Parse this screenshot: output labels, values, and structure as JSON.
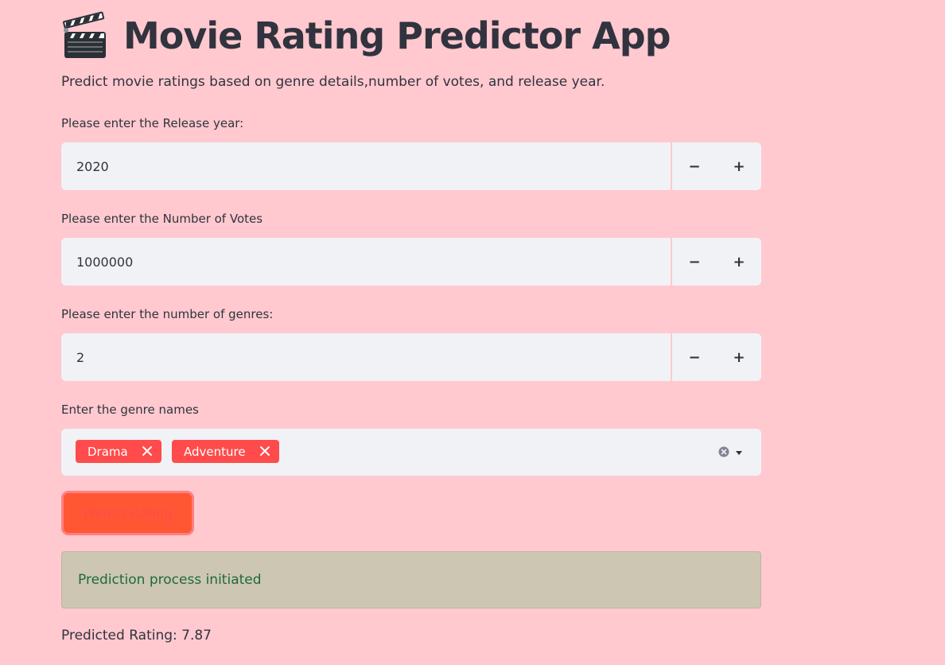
{
  "header": {
    "title": "Movie Rating Predictor App",
    "icon": "clapper-board-icon",
    "subtitle": "Predict movie ratings based on genre details,number of votes, and release year."
  },
  "form": {
    "release_year": {
      "label": "Please enter the Release year:",
      "value": "2020",
      "decrement": "−",
      "increment": "+"
    },
    "num_votes": {
      "label": "Please enter the Number of Votes",
      "value": "1000000",
      "decrement": "−",
      "increment": "+"
    },
    "num_genres": {
      "label": "Please enter the number of genres:",
      "value": "2",
      "decrement": "−",
      "increment": "+"
    },
    "genres": {
      "label": "Enter the genre names",
      "selected": [
        "Drama",
        "Adventure"
      ]
    },
    "predict_button": "Predict Rating"
  },
  "status": {
    "message": "Prediction process initiated",
    "result": "Predicted Rating: 7.87"
  },
  "colors": {
    "background": "#ffc9cf",
    "input_bg": "#f0f2f6",
    "tag": "#ff4b4b",
    "button": "#ff5733",
    "success_text": "#1e6b35"
  }
}
